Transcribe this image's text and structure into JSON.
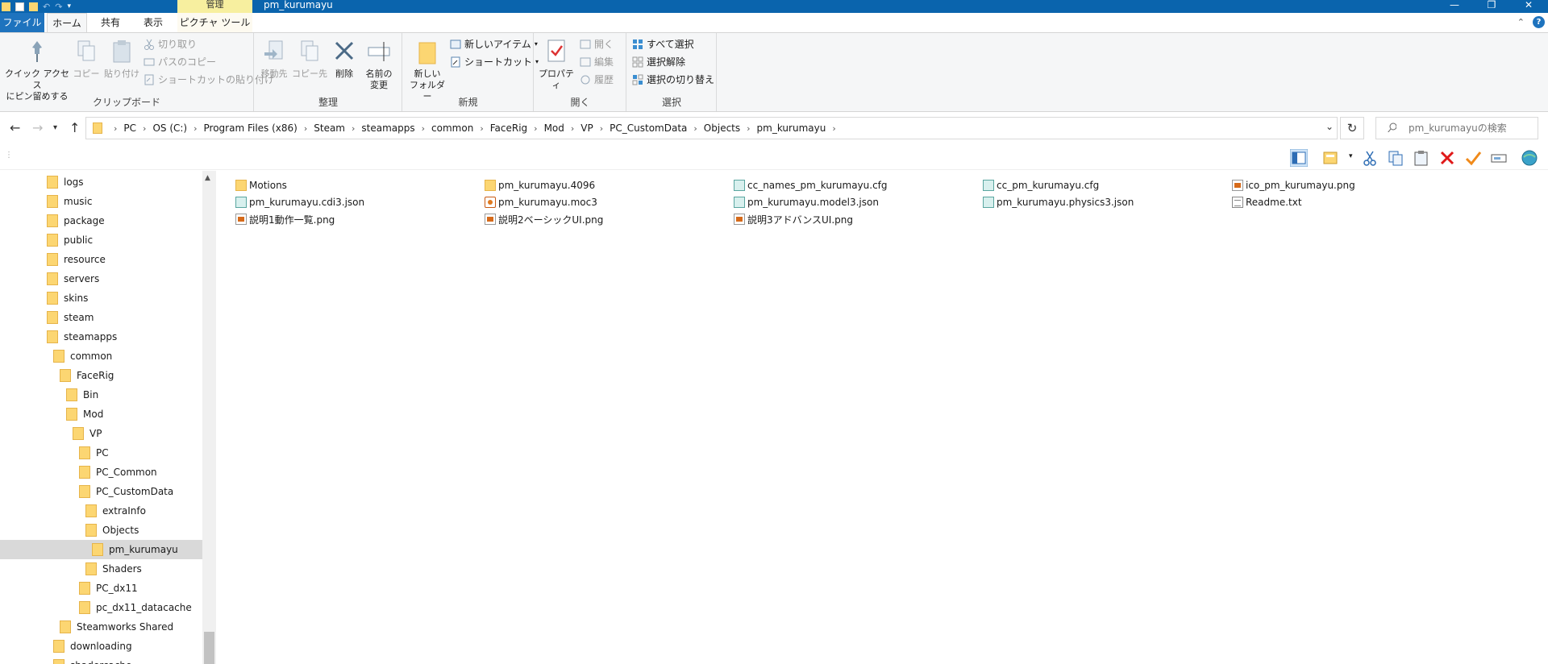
{
  "window": {
    "title": "pm_kurumayu",
    "context_tab_header": "管理",
    "buttons": {
      "minimize": "—",
      "maximize": "❐",
      "close": "✕"
    }
  },
  "tabs": {
    "file": "ファイル",
    "home": "ホーム",
    "share": "共有",
    "view": "表示",
    "picture_tools": "ピクチャ ツール",
    "help": "?",
    "collapse": "⌃"
  },
  "ribbon": {
    "clipboard": {
      "label": "クリップボード",
      "pin_line1": "クイック アクセス",
      "pin_line2": "にピン留めする",
      "copy": "コピー",
      "paste": "貼り付け",
      "cut": "切り取り",
      "copy_path": "パスのコピー",
      "paste_shortcut": "ショートカットの貼り付け"
    },
    "organize": {
      "label": "整理",
      "move_to": "移動先",
      "copy_to": "コピー先",
      "delete": "削除",
      "rename_line1": "名前の",
      "rename_line2": "変更"
    },
    "new": {
      "label": "新規",
      "new_folder_line1": "新しい",
      "new_folder_line2": "フォルダー",
      "new_item": "新しいアイテム",
      "shortcut": "ショートカット"
    },
    "open": {
      "label": "開く",
      "properties": "プロパティ",
      "open": "開く",
      "edit": "編集",
      "history": "履歴"
    },
    "select": {
      "label": "選択",
      "select_all": "すべて選択",
      "select_none": "選択解除",
      "invert": "選択の切り替え"
    }
  },
  "address": {
    "crumbs": [
      "PC",
      "OS (C:)",
      "Program Files (x86)",
      "Steam",
      "steamapps",
      "common",
      "FaceRig",
      "Mod",
      "VP",
      "PC_CustomData",
      "Objects",
      "pm_kurumayu"
    ],
    "search_placeholder": "pm_kurumayuの検索"
  },
  "nav_pane": {
    "items": [
      {
        "label": "logs",
        "indent": 0
      },
      {
        "label": "music",
        "indent": 0
      },
      {
        "label": "package",
        "indent": 0
      },
      {
        "label": "public",
        "indent": 0
      },
      {
        "label": "resource",
        "indent": 0
      },
      {
        "label": "servers",
        "indent": 0
      },
      {
        "label": "skins",
        "indent": 0
      },
      {
        "label": "steam",
        "indent": 0
      },
      {
        "label": "steamapps",
        "indent": 0
      },
      {
        "label": "common",
        "indent": 1
      },
      {
        "label": "FaceRig",
        "indent": 2
      },
      {
        "label": "Bin",
        "indent": 3
      },
      {
        "label": "Mod",
        "indent": 3
      },
      {
        "label": "VP",
        "indent": 4
      },
      {
        "label": "PC",
        "indent": 5
      },
      {
        "label": "PC_Common",
        "indent": 5
      },
      {
        "label": "PC_CustomData",
        "indent": 5
      },
      {
        "label": "extraInfo",
        "indent": 6
      },
      {
        "label": "Objects",
        "indent": 6
      },
      {
        "label": "pm_kurumayu",
        "indent": 7,
        "selected": true
      },
      {
        "label": "Shaders",
        "indent": 6
      },
      {
        "label": "PC_dx11",
        "indent": 5
      },
      {
        "label": "pc_dx11_datacache",
        "indent": 5
      },
      {
        "label": "Steamworks Shared",
        "indent": 2
      },
      {
        "label": "downloading",
        "indent": 1
      },
      {
        "label": "shadercache",
        "indent": 1
      }
    ]
  },
  "files": [
    {
      "name": "Motions",
      "type": "folder"
    },
    {
      "name": "pm_kurumayu.4096",
      "type": "folder"
    },
    {
      "name": "cc_names_pm_kurumayu.cfg",
      "type": "cfg"
    },
    {
      "name": "cc_pm_kurumayu.cfg",
      "type": "cfg"
    },
    {
      "name": "ico_pm_kurumayu.png",
      "type": "png"
    },
    {
      "name": "pm_kurumayu.cdi3.json",
      "type": "json"
    },
    {
      "name": "pm_kurumayu.moc3",
      "type": "moc"
    },
    {
      "name": "pm_kurumayu.model3.json",
      "type": "json"
    },
    {
      "name": "pm_kurumayu.physics3.json",
      "type": "json"
    },
    {
      "name": "Readme.txt",
      "type": "txt"
    },
    {
      "name": "説明1動作一覧.png",
      "type": "png"
    },
    {
      "name": "説明2ベーシックUI.png",
      "type": "png"
    },
    {
      "name": "説明3アドバンスUI.png",
      "type": "png"
    }
  ],
  "colors": {
    "titlebar": "#0a64ad",
    "accent": "#1e73be",
    "folder": "#fcd672",
    "selection": "#d9d9d9",
    "context_tab": "#f7ef9f"
  }
}
